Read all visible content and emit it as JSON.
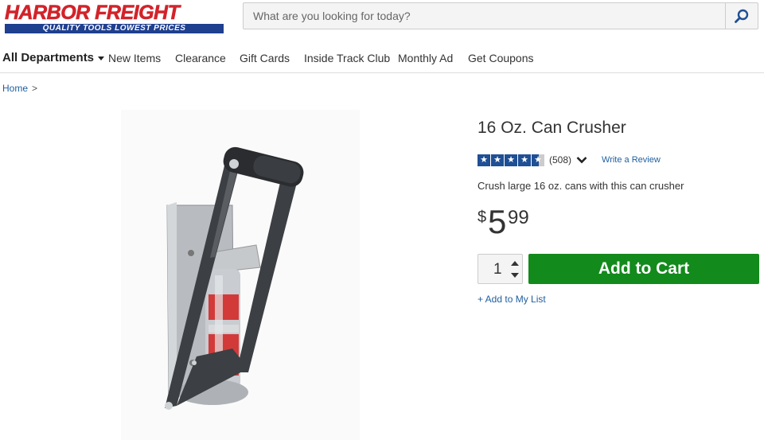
{
  "header": {
    "logo_main": "HARBOR FREIGHT",
    "logo_tagline": "QUALITY TOOLS   LOWEST PRICES",
    "search_placeholder": "What are you looking for today?"
  },
  "nav": {
    "departments": "All Departments",
    "items": [
      "New Items",
      "Clearance",
      "Gift Cards",
      "Inside Track Club",
      "Monthly Ad",
      "Get Coupons"
    ]
  },
  "breadcrumb": {
    "home": "Home",
    "separator": ">"
  },
  "product": {
    "title": "16 Oz. Can Crusher",
    "rating": 4.5,
    "rating_max": 5,
    "review_count": "(508)",
    "write_review": "Write a Review",
    "description": "Crush large 16 oz. cans with this can crusher",
    "price_symbol": "$",
    "price_dollars": "5",
    "price_cents": "99",
    "quantity": "1",
    "add_to_cart": "Add to Cart",
    "add_to_list": "+ Add to My List"
  },
  "colors": {
    "brand_red": "#d2232a",
    "brand_blue": "#1f3f8f",
    "cart_green": "#138a1c",
    "link_blue": "#1f5fa0"
  }
}
